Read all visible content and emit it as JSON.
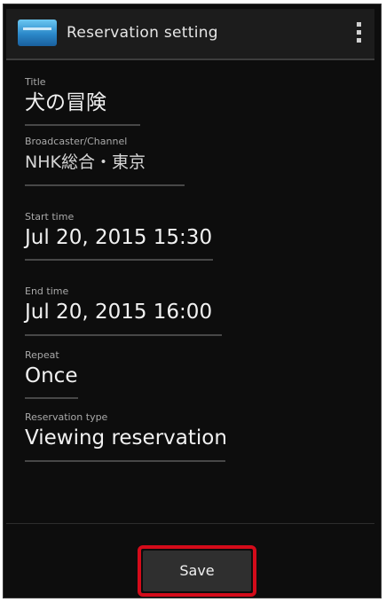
{
  "actionbar": {
    "title": "Reservation setting"
  },
  "fields": [
    {
      "label": "Title",
      "value": "犬の冒険"
    },
    {
      "label": "Broadcaster/Channel",
      "value": "NHK総合・東京"
    },
    {
      "label": "Start time",
      "value": "Jul 20, 2015 15:30"
    },
    {
      "label": "End time",
      "value": "Jul 20, 2015 16:00"
    },
    {
      "label": "Repeat",
      "value": "Once"
    },
    {
      "label": "Reservation type",
      "value": "Viewing reservation"
    }
  ],
  "footer": {
    "save_label": "Save"
  },
  "colors": {
    "highlight": "#d40b1a",
    "background": "#0d0d0d"
  }
}
